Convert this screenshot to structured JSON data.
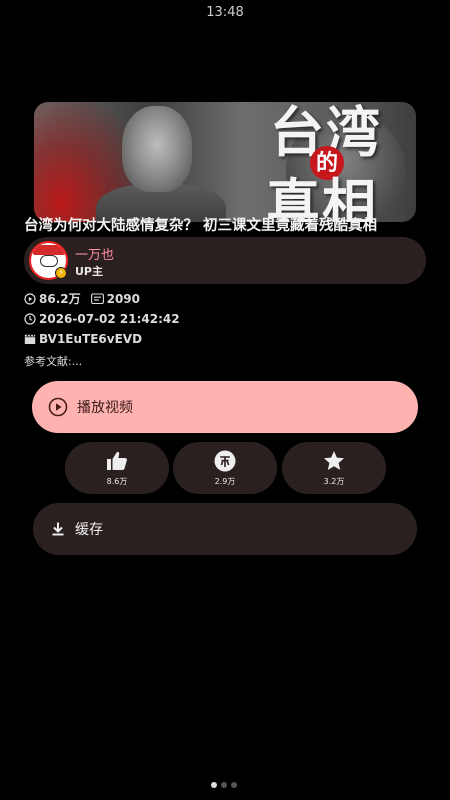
{
  "status_bar": {
    "time": "13:48"
  },
  "video": {
    "cover_text_line1": "台湾",
    "cover_text_de": "的",
    "cover_text_line2": "真相",
    "title": "台湾为何对大陆感情复杂？ 初三课文里竟藏着残酷真相",
    "uploader": {
      "name": "一万也",
      "role": "UP主"
    },
    "views": "86.2万",
    "danmaku": "2090",
    "publish_time": "2026-07-02 21:42:42",
    "bvid": "BV1EuTE6vEVD",
    "description": "参考文献:..."
  },
  "actions": {
    "play_label": "播放视频",
    "like_count": "8.6万",
    "coin_count": "2.9万",
    "favorite_count": "3.2万",
    "cache_label": "缓存"
  },
  "pager": {
    "pages": 3,
    "active": 0
  },
  "colors": {
    "accent": "#ffb3b0",
    "card": "#2a201f",
    "uploader_name": "#ff8fa3"
  }
}
